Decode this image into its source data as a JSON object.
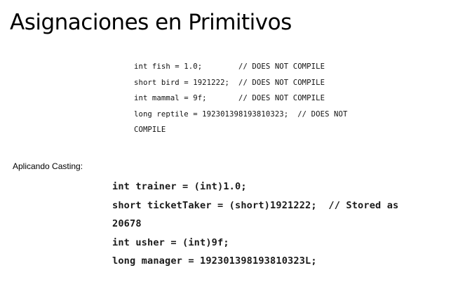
{
  "slide": {
    "title": "Asignaciones en Primitivos"
  },
  "invalid_code": {
    "lines": [
      "int fish = 1.0;        // DOES NOT COMPILE",
      "short bird = 1921222;  // DOES NOT COMPILE",
      "int mammal = 9f;       // DOES NOT COMPILE",
      "long reptile = 192301398193810323;  // DOES NOT",
      "COMPILE"
    ]
  },
  "casting_section": {
    "label": "Aplicando Casting:"
  },
  "casting_code": {
    "lines": [
      "int trainer = (int)1.0;",
      "short ticketTaker = (short)1921222;  // Stored as",
      "20678",
      "int usher = (int)9f;",
      "long manager = 192301398193810323L;"
    ]
  }
}
